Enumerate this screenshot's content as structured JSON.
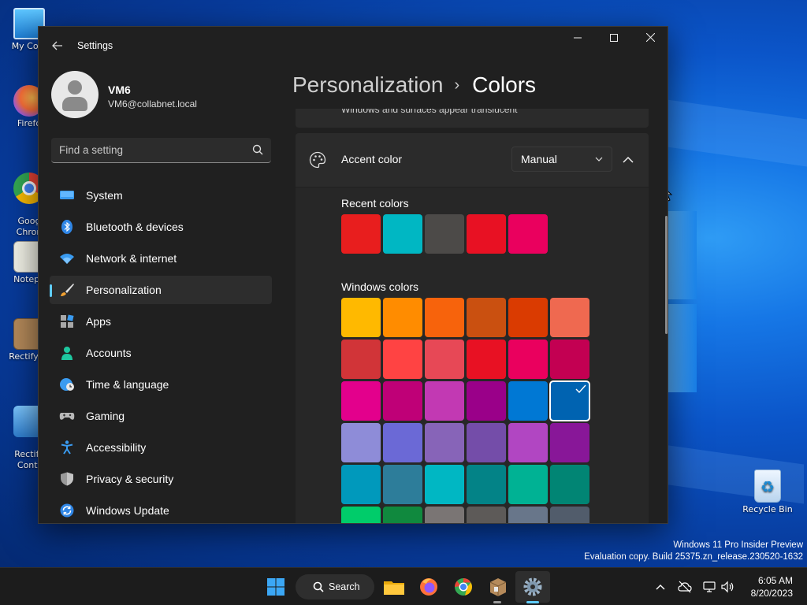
{
  "desktop": {
    "icons": [
      {
        "label": "My Com"
      },
      {
        "label": "Firefo"
      },
      {
        "label": "Goog\nChron"
      },
      {
        "label": "Notepa"
      },
      {
        "label": "Rectify11"
      },
      {
        "label": "Rectify\nContr"
      },
      {
        "label": "Recycle Bin"
      }
    ],
    "watermark": {
      "line1": "Windows 11 Pro Insider Preview",
      "line2": "Evaluation copy. Build 25375.zn_release.230520-1632"
    }
  },
  "window": {
    "title": "Settings",
    "profile": {
      "name": "VM6",
      "email": "VM6@collabnet.local"
    },
    "search": {
      "placeholder": "Find a setting"
    },
    "nav": [
      {
        "label": "System",
        "icon": "system-icon"
      },
      {
        "label": "Bluetooth & devices",
        "icon": "bluetooth-icon"
      },
      {
        "label": "Network & internet",
        "icon": "wifi-icon"
      },
      {
        "label": "Personalization",
        "icon": "brush-icon",
        "active": true
      },
      {
        "label": "Apps",
        "icon": "apps-icon"
      },
      {
        "label": "Accounts",
        "icon": "person-icon"
      },
      {
        "label": "Time & language",
        "icon": "globe-clock-icon"
      },
      {
        "label": "Gaming",
        "icon": "gamepad-icon"
      },
      {
        "label": "Accessibility",
        "icon": "accessibility-icon"
      },
      {
        "label": "Privacy & security",
        "icon": "shield-icon"
      },
      {
        "label": "Windows Update",
        "icon": "update-icon"
      }
    ],
    "breadcrumb": {
      "parent": "Personalization",
      "separator": "›",
      "current": "Colors"
    },
    "transparency_desc": "Windows and surfaces appear translucent",
    "accent": {
      "label": "Accent color",
      "mode": "Manual",
      "recent_label": "Recent colors",
      "recent_colors": [
        "#e81e1e",
        "#00b7c3",
        "#4c4a48",
        "#e81123",
        "#ea005e"
      ],
      "windows_label": "Windows colors",
      "windows_colors": [
        [
          "#ffb900",
          "#ff8c00",
          "#f7630c",
          "#ca5010",
          "#da3b01",
          "#ef6950"
        ],
        [
          "#d13438",
          "#ff4343",
          "#e74856",
          "#e81123",
          "#ea005e",
          "#c30052"
        ],
        [
          "#e3008c",
          "#bf0077",
          "#c239b3",
          "#9a0089",
          "#0078d4",
          "#0063b1"
        ],
        [
          "#8e8cd8",
          "#6b69d6",
          "#8764b8",
          "#744da9",
          "#b146c2",
          "#881798"
        ],
        [
          "#0099bc",
          "#2d7d9a",
          "#00b7c3",
          "#038387",
          "#00b294",
          "#018574"
        ],
        [
          "#00cc6a",
          "#10893e",
          "#7a7574",
          "#5d5a58",
          "#68768a",
          "#515c6b"
        ]
      ],
      "selected": "#0063b1"
    }
  },
  "taskbar": {
    "search_label": "Search",
    "apps": [
      "start-icon",
      "file-explorer-icon",
      "firefox-icon",
      "chrome-icon",
      "rectify-icon",
      "settings-icon"
    ],
    "clock": {
      "time": "6:05 AM",
      "date": "8/20/2023"
    }
  }
}
